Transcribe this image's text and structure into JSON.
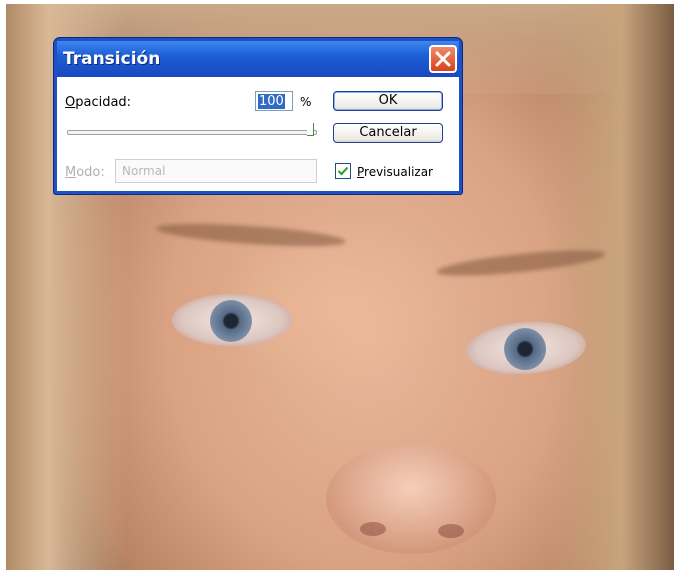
{
  "dialog": {
    "title": "Transición",
    "opacity": {
      "label_first": "O",
      "label_rest": "pacidad:",
      "value": "100",
      "unit": "%",
      "slider_percent": 100
    },
    "mode": {
      "label_first": "M",
      "label_rest": "odo:",
      "value": "Normal",
      "enabled": false
    },
    "buttons": {
      "ok_label": "OK",
      "cancel_label": "Cancelar"
    },
    "preview": {
      "label_first": "P",
      "label_rest": "revisualizar",
      "checked": true
    }
  },
  "icons": {
    "close": "close-icon",
    "check": "checkmark-icon"
  },
  "colors": {
    "titlebar": "#1d5fd6",
    "close_button": "#d9431c",
    "selection": "#316ac5"
  }
}
